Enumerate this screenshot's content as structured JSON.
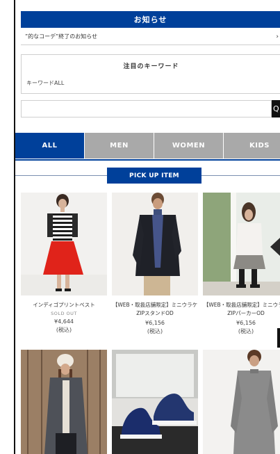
{
  "news": {
    "header": "お知らせ",
    "items": [
      {
        "text": "”的なコーデ”終了のお知らせ",
        "arrow": "›"
      }
    ]
  },
  "keyword": {
    "title": "注目のキーワード",
    "all_link": "キーワードALL"
  },
  "search": {
    "value": "",
    "placeholder": "",
    "button_glyph": "Q"
  },
  "tabs": [
    {
      "label": "ALL",
      "active": true
    },
    {
      "label": "MEN",
      "active": false
    },
    {
      "label": "WOMEN",
      "active": false
    },
    {
      "label": "KIDS",
      "active": false
    }
  ],
  "pickup": {
    "title": "PICK UP ITEM"
  },
  "products": [
    {
      "name": "インディゴプリントベスト",
      "status": "SOLD OUT",
      "price": "¥4,644",
      "tax": "(税込)"
    },
    {
      "name": "【WEB・取扱店舗限定】ミニウラケZIPスタンドOD",
      "status": "",
      "price": "¥6,156",
      "tax": "(税込)"
    },
    {
      "name": "【WEB・取扱店舗限定】ミニウラケZIPパーカーOD",
      "status": "",
      "price": "¥6,156",
      "tax": "(税込)"
    }
  ],
  "colors": {
    "brand_blue": "#00409a",
    "tab_gray": "#a9a9a9"
  }
}
